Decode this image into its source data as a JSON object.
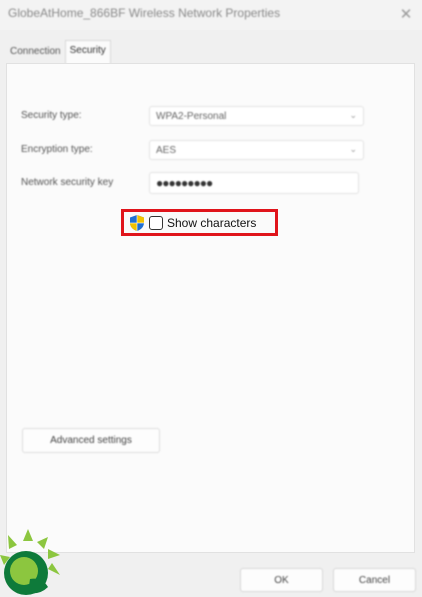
{
  "window": {
    "title": "GlobeAtHome_866BF Wireless Network Properties",
    "close_glyph": "✕"
  },
  "tabs": [
    {
      "label": "Connection",
      "active": false
    },
    {
      "label": "Security",
      "active": true
    }
  ],
  "security": {
    "type_label": "Security type:",
    "type_value": "WPA2-Personal",
    "encryption_label": "Encryption type:",
    "encryption_value": "AES",
    "key_label": "Network security key",
    "key_value": "●●●●●●●●●",
    "show_characters_label": "Show characters",
    "show_characters_checked": false,
    "highlight_color": "#e0141b"
  },
  "buttons": {
    "advanced": "Advanced settings",
    "ok": "OK",
    "cancel": "Cancel"
  },
  "icons": {
    "dropdown": "chevron-down-icon",
    "shield": "uac-shield-icon",
    "close": "close-icon",
    "logo": "sun-logo-icon"
  }
}
